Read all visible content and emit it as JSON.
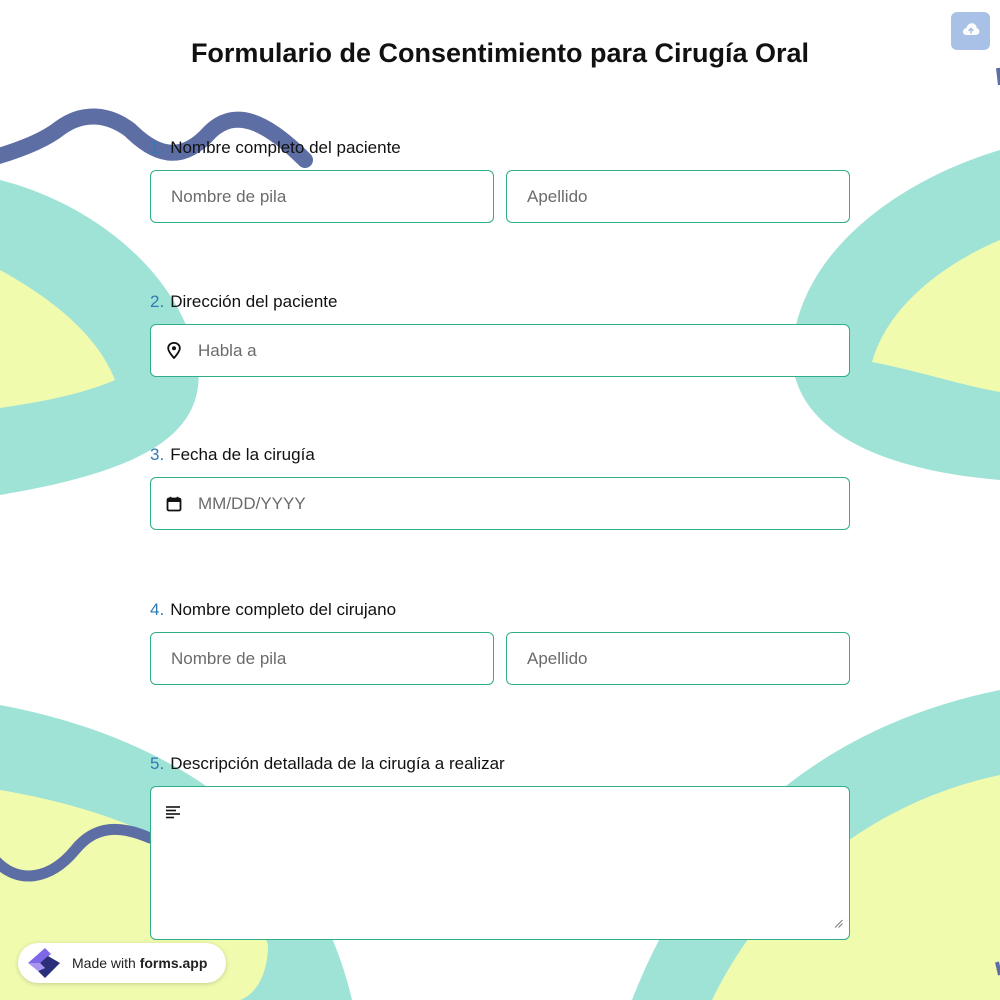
{
  "form": {
    "title": "Formulario de Consentimiento para Cirugía Oral",
    "questions": [
      {
        "number": "1.",
        "label": "Nombre completo del paciente",
        "first_placeholder": "Nombre de pila",
        "last_placeholder": "Apellido"
      },
      {
        "number": "2.",
        "label": "Dirección del paciente",
        "placeholder": "Habla a",
        "icon": "map-pin-icon"
      },
      {
        "number": "3.",
        "label": "Fecha de la cirugía",
        "placeholder": "MM/DD/YYYY",
        "icon": "calendar-icon"
      },
      {
        "number": "4.",
        "label": "Nombre completo del cirujano",
        "first_placeholder": "Nombre de pila",
        "last_placeholder": "Apellido"
      },
      {
        "number": "5.",
        "label": "Descripción detallada de la cirugía a realizar",
        "placeholder": "",
        "icon": "text-align-icon"
      }
    ]
  },
  "toolbar": {
    "upload_icon": "cloud-upload-icon"
  },
  "badge": {
    "prefix": "Made with ",
    "brand": "forms.app",
    "icon": "forms-app-logo"
  },
  "colors": {
    "accent_border": "#2fae89",
    "number_color": "#2e7bb4",
    "teal": "#9fe3d7",
    "yellow": "#f1fbae",
    "navy": "#5d6ea5",
    "upload_button": "#a9c1e6"
  }
}
